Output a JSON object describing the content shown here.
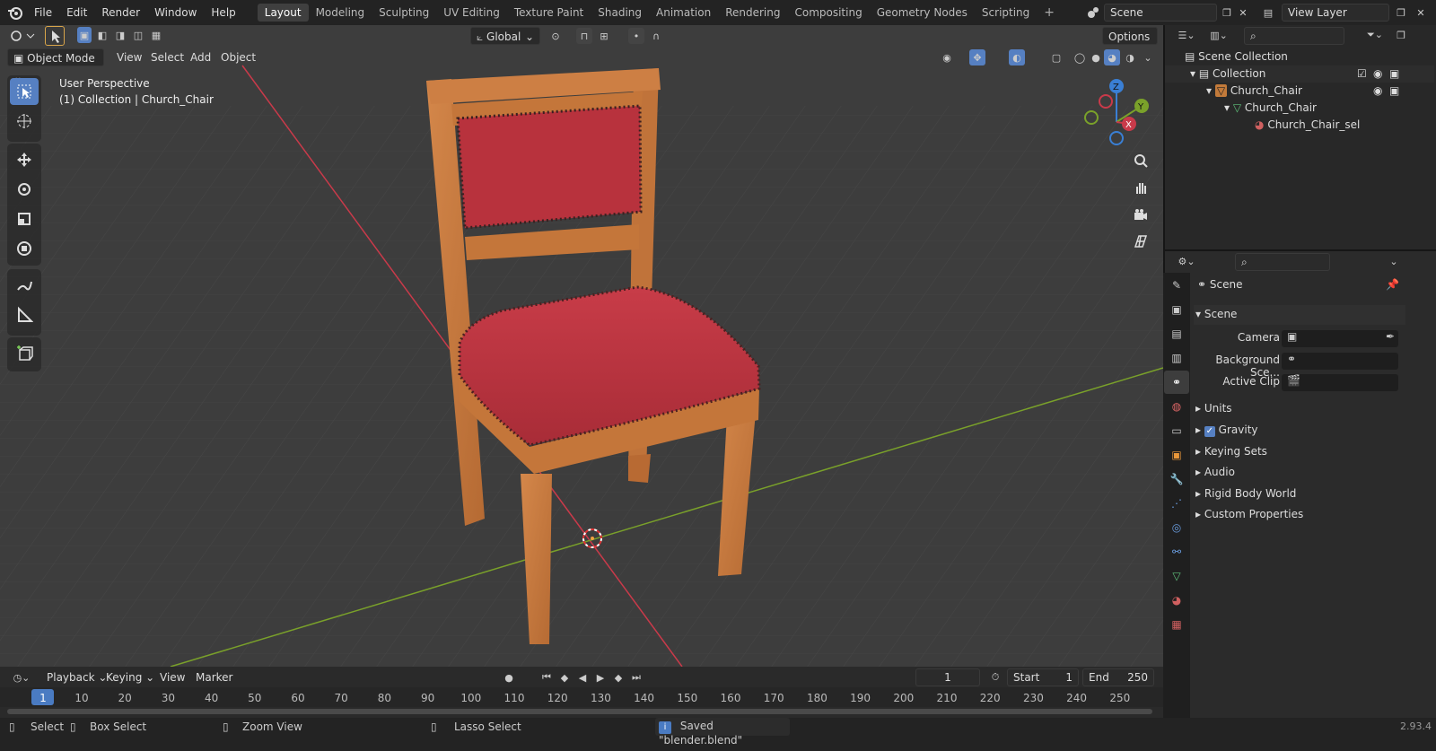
{
  "menu": [
    "File",
    "Edit",
    "Render",
    "Window",
    "Help"
  ],
  "workspaces": [
    "Layout",
    "Modeling",
    "Sculpting",
    "UV Editing",
    "Texture Paint",
    "Shading",
    "Animation",
    "Rendering",
    "Compositing",
    "Geometry Nodes",
    "Scripting"
  ],
  "active_workspace": "Layout",
  "scene_field": "Scene",
  "view_layer_field": "View Layer",
  "viewport": {
    "transform_orientation": "Global",
    "options_label": "Options",
    "mode": "Object Mode",
    "header_menus": [
      "View",
      "Select",
      "Add",
      "Object"
    ],
    "overlay_line1": "User Perspective",
    "overlay_line2": "(1) Collection | Church_Chair",
    "gizmo_axes": {
      "z": "Z",
      "y": "Y",
      "x": "X"
    }
  },
  "outliner": {
    "rows": [
      {
        "label": "Scene Collection"
      },
      {
        "label": "Collection"
      },
      {
        "label": "Church_Chair"
      },
      {
        "label": "Church_Chair"
      },
      {
        "label": "Church_Chair_sel"
      }
    ]
  },
  "properties": {
    "context_title": "Scene",
    "panel_title": "Scene",
    "fields": [
      {
        "label": "Camera"
      },
      {
        "label": "Background Sce..."
      },
      {
        "label": "Active Clip"
      }
    ],
    "subpanels": [
      "Units",
      "Gravity",
      "Keying Sets",
      "Audio",
      "Rigid Body World",
      "Custom Properties"
    ],
    "gravity_checked": true
  },
  "timeline": {
    "menus": [
      "Playback",
      "Keying",
      "View",
      "Marker"
    ],
    "current_frame": "1",
    "start_label": "Start",
    "start_value": "1",
    "end_label": "End",
    "end_value": "250",
    "ruler": [
      "1",
      "10",
      "20",
      "30",
      "40",
      "50",
      "60",
      "70",
      "80",
      "90",
      "100",
      "110",
      "120",
      "130",
      "140",
      "150",
      "160",
      "170",
      "180",
      "190",
      "200",
      "210",
      "220",
      "230",
      "240",
      "250"
    ]
  },
  "statusbar": {
    "select": "Select",
    "box_select": "Box Select",
    "zoom_view": "Zoom View",
    "lasso_select": "Lasso Select",
    "message": "Saved \"blender.blend\"",
    "version": "2.93.4"
  },
  "colors": {
    "accent": "#5680c2",
    "x_axis": "#c93a4a",
    "y_axis": "#7aa12a",
    "z_axis": "#3a7fd4",
    "upholstery": "#b8323d",
    "wood": "#c4763a"
  }
}
